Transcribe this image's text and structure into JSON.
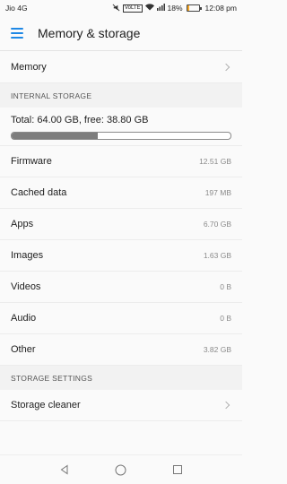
{
  "status_bar": {
    "carrier": "Jio 4G",
    "volte": "VoLTE",
    "battery_text": "18%",
    "time": "12:08 pm"
  },
  "toolbar": {
    "title": "Memory & storage"
  },
  "memory_row": {
    "label": "Memory"
  },
  "internal_storage": {
    "header": "INTERNAL STORAGE",
    "total_text": "Total: 64.00 GB, free: 38.80 GB",
    "used_fraction": 0.394,
    "items": [
      {
        "label": "Firmware",
        "value": "12.51 GB"
      },
      {
        "label": "Cached data",
        "value": "197 MB"
      },
      {
        "label": "Apps",
        "value": "6.70 GB"
      },
      {
        "label": "Images",
        "value": "1.63 GB"
      },
      {
        "label": "Videos",
        "value": "0 B"
      },
      {
        "label": "Audio",
        "value": "0 B"
      },
      {
        "label": "Other",
        "value": "3.82 GB"
      }
    ]
  },
  "storage_settings": {
    "header": "STORAGE SETTINGS",
    "cleaner_label": "Storage cleaner"
  },
  "colors": {
    "accent": "#1e88e5",
    "bar_fill": "#7d7d7d",
    "battery": "#f5a623"
  },
  "icons": {
    "menu": "menu-icon",
    "chevron": "chevron-right-icon",
    "back": "back-icon",
    "home": "home-icon",
    "recents": "recents-icon"
  }
}
